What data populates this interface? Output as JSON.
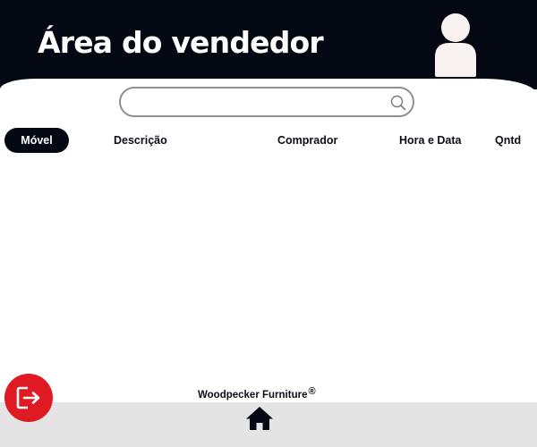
{
  "header": {
    "title": "Área do vendedor",
    "avatar_icon": "user-avatar-icon",
    "background_color": "#030812"
  },
  "search": {
    "value": "",
    "placeholder": "",
    "icon": "search-icon"
  },
  "columns": [
    {
      "label": "Móvel",
      "active": true
    },
    {
      "label": "Descrição",
      "active": false
    },
    {
      "label": "Comprador",
      "active": false
    },
    {
      "label": "Hora e Data",
      "active": false
    },
    {
      "label": "Qntd",
      "active": false
    }
  ],
  "footer": {
    "brand": "Woodpecker Furniture",
    "registered_mark": "®",
    "home_icon": "home-icon",
    "bar_color": "#e4e4e4"
  },
  "logout": {
    "icon": "logout-icon",
    "color": "#e01a23"
  }
}
